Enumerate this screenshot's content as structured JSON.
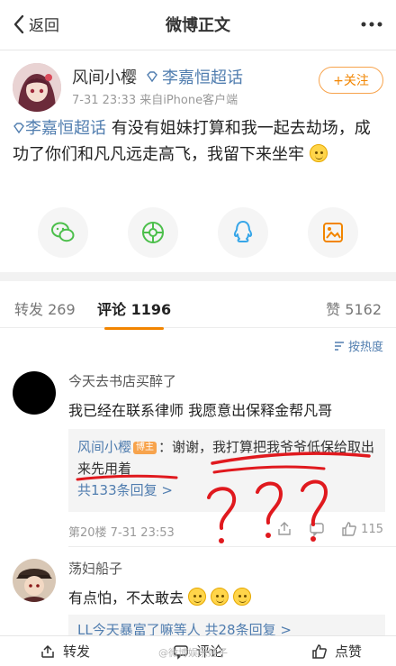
{
  "nav": {
    "back_label": "返回",
    "title": "微博正文"
  },
  "post": {
    "username": "风间小樱",
    "topic_tag": "李嘉恒超话",
    "meta": "7-31 23:33  来自iPhone客户端",
    "follow_label": "+关注",
    "topic": "李嘉恒超话",
    "text": " 有没有姐妹打算和我一起去劫场，成功了你们和凡凡远走高飞，我留下来坐牢"
  },
  "share_icons": [
    "wechat-icon",
    "moments-icon",
    "qq-icon",
    "image-icon"
  ],
  "tabs": {
    "repost_label": "转发",
    "repost_count": "269",
    "comment_label": "评论",
    "comment_count": "1196",
    "like_label": "赞",
    "like_count": "5162"
  },
  "sort_label": "按热度",
  "comments": [
    {
      "name": "今天去书店买醉了",
      "text": "我已经在联系律师 我愿意出保释金帮凡哥",
      "reply_name": "风间小樱",
      "reply_badge": "博主",
      "reply_text": "：谢谢，我打算把我爷爷低保给取出来先用着",
      "reply_more": "共133条回复 >",
      "meta": "第20楼  7-31 23:53",
      "likes": "115"
    },
    {
      "name": "荡妇船子",
      "text": "有点怕，不太敢去",
      "reply_text": "LL今天暴富了嘛等人",
      "reply_more": " 共28条回复 >"
    }
  ],
  "bottom_bar": {
    "repost": "转发",
    "comment": "评论",
    "like": "点赞"
  },
  "watermark": "@微博娱乐娃子",
  "colors": {
    "link": "#507daf",
    "accent": "#f28500",
    "annotation": "#e0191e"
  }
}
